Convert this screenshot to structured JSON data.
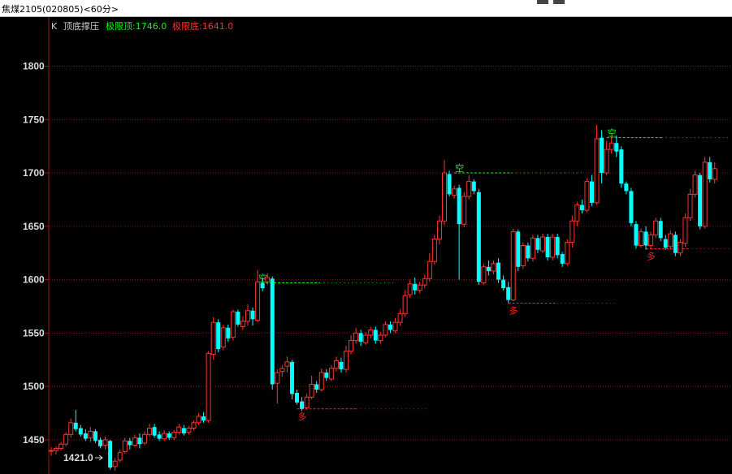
{
  "window": {
    "title": "焦煤2105(020805)<60分>"
  },
  "indicator": {
    "k": "K",
    "name": "顶底撑压",
    "top_label": "极限顶:1746.0",
    "bottom_label": "极限底:1641.0"
  },
  "low_marker": "1421.0",
  "colors": {
    "up": "#ff3232",
    "down": "#00ffff",
    "grid": "#8a1010",
    "top_sig": "#00ff00",
    "bottom_sig": "#ff2020",
    "axis": "#aa1111"
  },
  "chart_data": {
    "type": "candlestick",
    "y_ticks": [
      1800,
      1750,
      1700,
      1650,
      1600,
      1550,
      1500,
      1450
    ],
    "ylim": [
      1418,
      1846
    ],
    "candles": [
      [
        1440,
        1440,
        1435,
        1443
      ],
      [
        1440,
        1442,
        1436,
        1444
      ],
      [
        1442,
        1446,
        1440,
        1448
      ],
      [
        1446,
        1455,
        1444,
        1457
      ],
      [
        1455,
        1466,
        1452,
        1470
      ],
      [
        1466,
        1460,
        1458,
        1478
      ],
      [
        1461,
        1455,
        1453,
        1464
      ],
      [
        1456,
        1451,
        1449,
        1460
      ],
      [
        1452,
        1458,
        1448,
        1462
      ],
      [
        1458,
        1449,
        1447,
        1460
      ],
      [
        1450,
        1444,
        1442,
        1452
      ],
      [
        1445,
        1450,
        1441,
        1453
      ],
      [
        1449,
        1424,
        1422,
        1450
      ],
      [
        1425,
        1430,
        1421,
        1433
      ],
      [
        1431,
        1438,
        1429,
        1441
      ],
      [
        1439,
        1449,
        1437,
        1452
      ],
      [
        1449,
        1445,
        1441,
        1452
      ],
      [
        1445,
        1452,
        1443,
        1455
      ],
      [
        1452,
        1446,
        1442,
        1456
      ],
      [
        1447,
        1455,
        1445,
        1458
      ],
      [
        1455,
        1461,
        1453,
        1465
      ],
      [
        1462,
        1454,
        1452,
        1465
      ],
      [
        1455,
        1451,
        1449,
        1458
      ],
      [
        1451,
        1456,
        1449,
        1459
      ],
      [
        1456,
        1452,
        1450,
        1458
      ],
      [
        1452,
        1457,
        1450,
        1459
      ],
      [
        1457,
        1462,
        1455,
        1465
      ],
      [
        1461,
        1456,
        1454,
        1464
      ],
      [
        1457,
        1461,
        1455,
        1463
      ],
      [
        1461,
        1466,
        1459,
        1468
      ],
      [
        1466,
        1472,
        1464,
        1475
      ],
      [
        1472,
        1468,
        1466,
        1476
      ],
      [
        1468,
        1531,
        1466,
        1533
      ],
      [
        1530,
        1560,
        1525,
        1565
      ],
      [
        1560,
        1535,
        1532,
        1563
      ],
      [
        1537,
        1555,
        1534,
        1558
      ],
      [
        1555,
        1545,
        1542,
        1558
      ],
      [
        1546,
        1570,
        1543,
        1572
      ],
      [
        1570,
        1558,
        1556,
        1572
      ],
      [
        1556,
        1561,
        1553,
        1566
      ],
      [
        1561,
        1571,
        1557,
        1577
      ],
      [
        1571,
        1563,
        1557,
        1574
      ],
      [
        1562,
        1598,
        1560,
        1609
      ],
      [
        1597,
        1592,
        1589,
        1602
      ],
      [
        1598,
        1602,
        1595,
        1606
      ],
      [
        1601,
        1502,
        1497,
        1603
      ],
      [
        1503,
        1513,
        1484,
        1516
      ],
      [
        1514,
        1517,
        1509,
        1520
      ],
      [
        1519,
        1523,
        1513,
        1528
      ],
      [
        1523,
        1493,
        1488,
        1525
      ],
      [
        1494,
        1485,
        1483,
        1497
      ],
      [
        1486,
        1479,
        1477,
        1490
      ],
      [
        1480,
        1490,
        1478,
        1493
      ],
      [
        1490,
        1502,
        1488,
        1510
      ],
      [
        1502,
        1497,
        1494,
        1505
      ],
      [
        1497,
        1513,
        1495,
        1517
      ],
      [
        1513,
        1508,
        1505,
        1516
      ],
      [
        1507,
        1517,
        1505,
        1520
      ],
      [
        1517,
        1524,
        1514,
        1528
      ],
      [
        1523,
        1516,
        1513,
        1527
      ],
      [
        1516,
        1533,
        1513,
        1538
      ],
      [
        1533,
        1543,
        1530,
        1548
      ],
      [
        1543,
        1550,
        1540,
        1555
      ],
      [
        1550,
        1542,
        1538,
        1553
      ],
      [
        1541,
        1548,
        1539,
        1551
      ],
      [
        1548,
        1553,
        1545,
        1556
      ],
      [
        1553,
        1543,
        1540,
        1556
      ],
      [
        1543,
        1548,
        1540,
        1551
      ],
      [
        1548,
        1558,
        1546,
        1561
      ],
      [
        1558,
        1553,
        1550,
        1561
      ],
      [
        1552,
        1560,
        1550,
        1564
      ],
      [
        1560,
        1568,
        1557,
        1572
      ],
      [
        1568,
        1585,
        1565,
        1590
      ],
      [
        1586,
        1596,
        1583,
        1600
      ],
      [
        1596,
        1590,
        1586,
        1602
      ],
      [
        1590,
        1595,
        1587,
        1598
      ],
      [
        1595,
        1601,
        1592,
        1605
      ],
      [
        1601,
        1617,
        1598,
        1625
      ],
      [
        1617,
        1638,
        1614,
        1642
      ],
      [
        1638,
        1655,
        1633,
        1660
      ],
      [
        1655,
        1700,
        1651,
        1712
      ],
      [
        1699,
        1680,
        1678,
        1702
      ],
      [
        1679,
        1685,
        1676,
        1688
      ],
      [
        1686,
        1652,
        1600,
        1689
      ],
      [
        1652,
        1678,
        1649,
        1682
      ],
      [
        1678,
        1692,
        1675,
        1698
      ],
      [
        1692,
        1683,
        1680,
        1694
      ],
      [
        1682,
        1598,
        1595,
        1685
      ],
      [
        1597,
        1612,
        1595,
        1615
      ],
      [
        1612,
        1608,
        1604,
        1618
      ],
      [
        1608,
        1615,
        1605,
        1618
      ],
      [
        1616,
        1600,
        1597,
        1620
      ],
      [
        1600,
        1592,
        1590,
        1604
      ],
      [
        1593,
        1581,
        1578,
        1598
      ],
      [
        1581,
        1645,
        1580,
        1648
      ],
      [
        1645,
        1612,
        1608,
        1647
      ],
      [
        1613,
        1632,
        1610,
        1635
      ],
      [
        1632,
        1620,
        1617,
        1635
      ],
      [
        1620,
        1639,
        1617,
        1642
      ],
      [
        1639,
        1628,
        1625,
        1642
      ],
      [
        1627,
        1640,
        1625,
        1643
      ],
      [
        1640,
        1621,
        1618,
        1643
      ],
      [
        1621,
        1640,
        1618,
        1643
      ],
      [
        1640,
        1623,
        1620,
        1643
      ],
      [
        1624,
        1615,
        1612,
        1626
      ],
      [
        1615,
        1635,
        1613,
        1638
      ],
      [
        1635,
        1655,
        1630,
        1660
      ],
      [
        1655,
        1670,
        1650,
        1673
      ],
      [
        1670,
        1665,
        1662,
        1675
      ],
      [
        1665,
        1692,
        1663,
        1695
      ],
      [
        1692,
        1672,
        1669,
        1698
      ],
      [
        1672,
        1732,
        1670,
        1745
      ],
      [
        1733,
        1700,
        1690,
        1740
      ],
      [
        1700,
        1722,
        1698,
        1730
      ],
      [
        1722,
        1728,
        1718,
        1735
      ],
      [
        1728,
        1720,
        1715,
        1735
      ],
      [
        1722,
        1690,
        1686,
        1725
      ],
      [
        1690,
        1683,
        1680,
        1692
      ],
      [
        1683,
        1653,
        1650,
        1686
      ],
      [
        1652,
        1632,
        1629,
        1655
      ],
      [
        1632,
        1645,
        1630,
        1648
      ],
      [
        1645,
        1632,
        1628,
        1650
      ],
      [
        1632,
        1642,
        1629,
        1645
      ],
      [
        1642,
        1655,
        1639,
        1658
      ],
      [
        1655,
        1639,
        1636,
        1658
      ],
      [
        1638,
        1630,
        1628,
        1642
      ],
      [
        1631,
        1643,
        1628,
        1646
      ],
      [
        1642,
        1625,
        1622,
        1645
      ],
      [
        1625,
        1635,
        1622,
        1638
      ],
      [
        1634,
        1658,
        1631,
        1662
      ],
      [
        1658,
        1680,
        1655,
        1685
      ],
      [
        1680,
        1698,
        1677,
        1702
      ],
      [
        1698,
        1650,
        1647,
        1700
      ],
      [
        1650,
        1710,
        1648,
        1715
      ],
      [
        1710,
        1694,
        1691,
        1715
      ],
      [
        1694,
        1704,
        1690,
        1710
      ]
    ],
    "signals": [
      {
        "type": "top",
        "label": "空",
        "level": 1597,
        "from": 42,
        "to": 70
      },
      {
        "type": "bottom",
        "label": "多",
        "level": 1479,
        "from": 50,
        "to": 77
      },
      {
        "type": "top",
        "label": "空",
        "level": 1700,
        "from": 82,
        "to": 108
      },
      {
        "type": "bottom",
        "label": "多",
        "level": 1578,
        "from": 93,
        "to": 115
      },
      {
        "type": "top",
        "label": "空",
        "level": 1733,
        "from": 113,
        "to": 138
      },
      {
        "type": "bottom",
        "label": "多",
        "level": 1629,
        "from": 121,
        "to": 140
      }
    ]
  }
}
